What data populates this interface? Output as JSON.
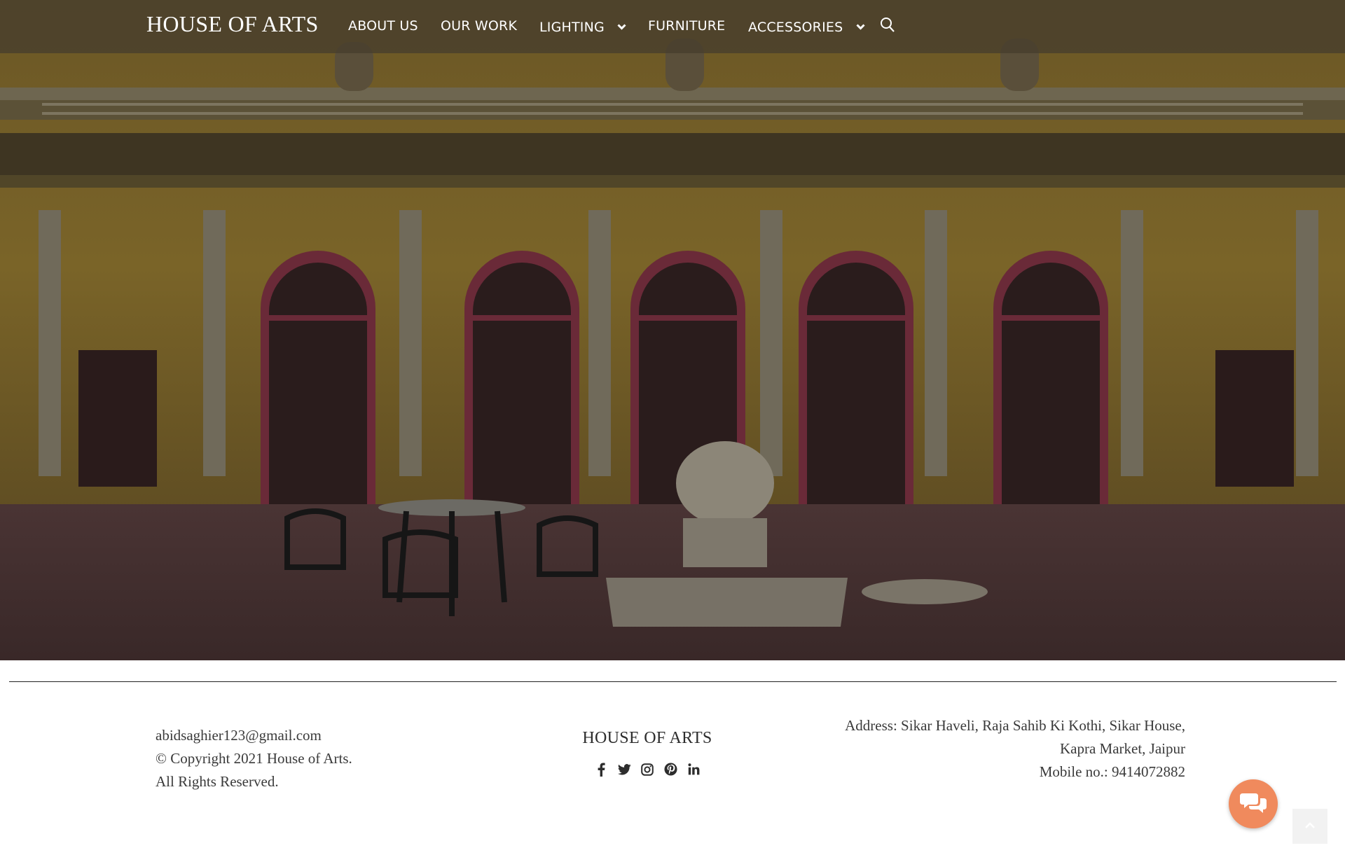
{
  "header": {
    "brand": "HOUSE OF ARTS",
    "nav": [
      {
        "label": "ABOUT US",
        "has_dropdown": false
      },
      {
        "label": "OUR WORK",
        "has_dropdown": false
      },
      {
        "label": "LIGHTING",
        "has_dropdown": true
      },
      {
        "label": "FURNITURE",
        "has_dropdown": false
      },
      {
        "label": "ACCESSORIES",
        "has_dropdown": true
      }
    ],
    "search_icon": "search-icon"
  },
  "hero": {
    "image": "haveli courtyard with arched doors, cast-iron garden furniture and marble planter"
  },
  "footer": {
    "email": "abidsaghier123@gmail.com",
    "copyright": "© Copyright 2021 House of Arts.",
    "rights": "All Rights Reserved.",
    "brand": "HOUSE OF ARTS",
    "socials": [
      "facebook-icon",
      "twitter-icon",
      "instagram-icon",
      "pinterest-icon",
      "linkedin-icon"
    ],
    "address_line1": "Address: Sikar Haveli, Raja Sahib Ki Kothi, Sikar House,",
    "address_line2": "Kapra Market, Jaipur",
    "mobile": "Mobile no.: 9414072882"
  },
  "widgets": {
    "chat_icon": "chat-icon",
    "scroll_top_icon": "chevron-up-icon"
  },
  "colors": {
    "nav_overlay": "#463e2d",
    "chat_button": "#f08a5d",
    "footer_text": "#3a3a3a"
  }
}
